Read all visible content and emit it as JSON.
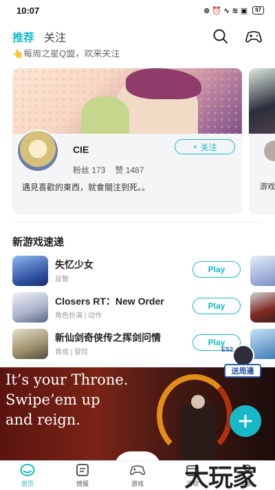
{
  "status_bar": {
    "time": "10:07",
    "icons_text": "⊗ ⏰ ∿ ≋ ▣",
    "battery": "97"
  },
  "top_nav": {
    "tabs": [
      {
        "label": "推荐",
        "active": true
      },
      {
        "label": "关注",
        "active": false
      }
    ],
    "icons": [
      "search-icon",
      "gamepad-icon"
    ]
  },
  "banner_strip": {
    "text": "👆每周之星Q盟，欢来关注"
  },
  "user_card": {
    "username": "CIE",
    "follow_label": "关注",
    "fans_label": "粉丝 173",
    "likes_label": "赞 1487",
    "bio": "遇見喜歡的東西，就會關注到死。。"
  },
  "peek_card": {
    "bio_fragment": "游戏"
  },
  "section": {
    "title": "新游戏速递"
  },
  "games": [
    {
      "name": "失忆少女",
      "tags": "益智",
      "button": "Play",
      "color": "#3f72c6"
    },
    {
      "name": "Closers RT：New Order",
      "tags": "角色扮演 | 动作",
      "button": "Play",
      "color": "#c9cfe0"
    },
    {
      "name": "新仙剑奇侠传之挥剑问情",
      "tags": "育成 | 冒险",
      "button": "Play",
      "color": "#b7a27a"
    }
  ],
  "mascot": {
    "badge": "送周邊",
    "tag": "ES2"
  },
  "ad": {
    "lines": [
      "It’s your Throne.",
      "Swipe’em up",
      "and reign."
    ]
  },
  "bottom_nav": {
    "items": [
      {
        "label": "首页",
        "active": true
      },
      {
        "label": "情报",
        "active": false
      },
      {
        "label": "游戏",
        "active": false
      },
      {
        "label": "活动",
        "active": false
      },
      {
        "label": "我的",
        "active": false
      }
    ]
  },
  "watermark": {
    "text": "大玩家"
  },
  "colors": {
    "accent": "#16b8c6"
  }
}
